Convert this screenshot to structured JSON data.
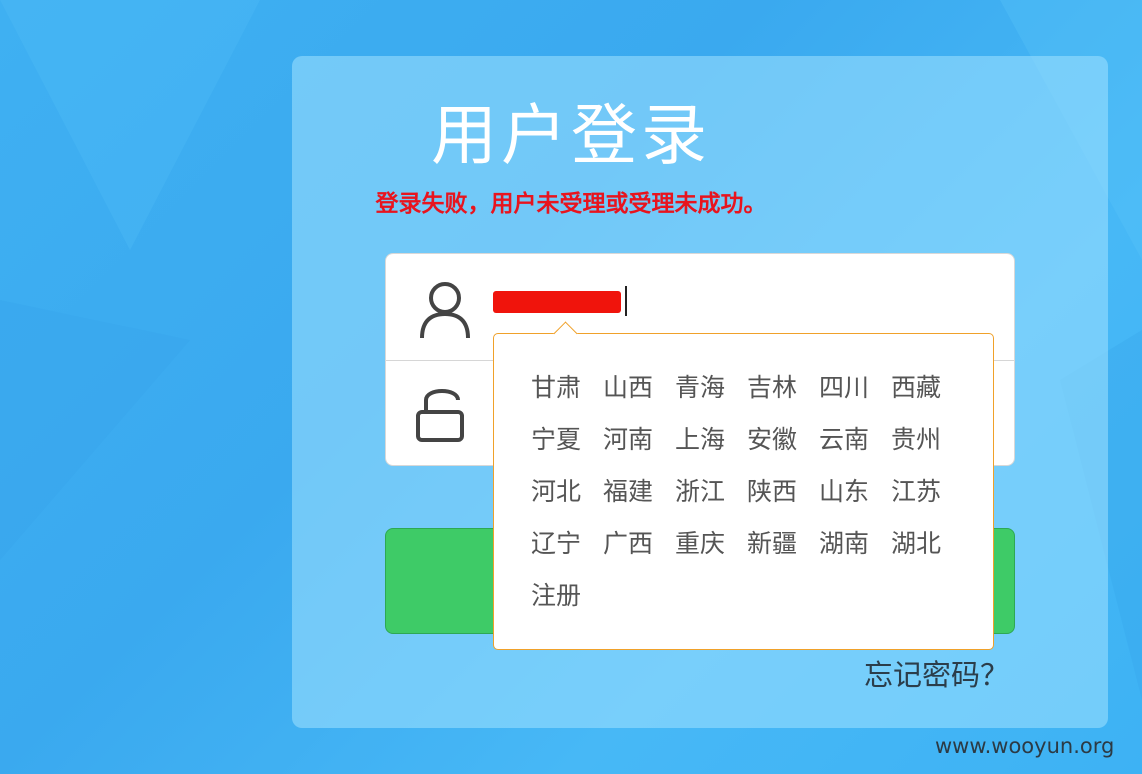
{
  "title": "用户登录",
  "error_message": "登录失败，用户未受理或受理未成功。",
  "username": {
    "value": ""
  },
  "password": {
    "value": ""
  },
  "login_button": {
    "label": ""
  },
  "forgot_password": "忘记密码？",
  "suggestions": [
    "甘肃",
    "山西",
    "青海",
    "吉林",
    "四川",
    "西藏",
    "宁夏",
    "河南",
    "上海",
    "安徽",
    "云南",
    "贵州",
    "河北",
    "福建",
    "浙江",
    "陕西",
    "山东",
    "江苏",
    "辽宁",
    "广西",
    "重庆",
    "新疆",
    "湖南",
    "湖北",
    "注册"
  ],
  "watermark": "www.wooyun.org",
  "colors": {
    "background": "#3fb0f2",
    "error": "#e8141e",
    "button": "#3ecb67",
    "popup_border": "#f0a12a",
    "redaction": "#f0140c"
  },
  "icons": {
    "username": "user-icon",
    "password": "lock-icon"
  }
}
